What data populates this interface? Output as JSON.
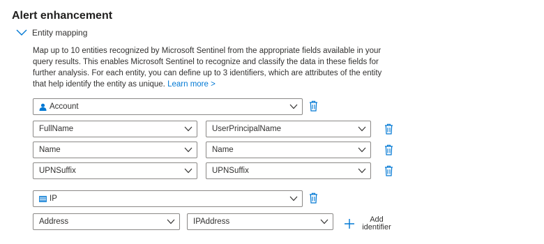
{
  "section": {
    "title": "Alert enhancement"
  },
  "entity_mapping": {
    "label": "Entity mapping",
    "description": "Map up to 10 entities recognized by Microsoft Sentinel from the appropriate fields available in your query results. This enables Microsoft Sentinel to recognize and classify the data in these fields for further analysis. For each entity, you can define up to 3 identifiers, which are attributes of the entity that help identify the entity as unique.",
    "learn_more": "Learn more >"
  },
  "entities": [
    {
      "type": "Account",
      "icon": "account-icon",
      "identifiers": [
        {
          "identifier": "FullName",
          "column": "UserPrincipalName"
        },
        {
          "identifier": "Name",
          "column": "Name"
        },
        {
          "identifier": "UPNSuffix",
          "column": "UPNSuffix"
        }
      ]
    },
    {
      "type": "IP",
      "icon": "ip-icon",
      "identifiers": [
        {
          "identifier": "Address",
          "column": "IPAddress"
        }
      ]
    }
  ],
  "add_identifier_label": "Add identifier",
  "colors": {
    "accent": "#0078d4",
    "border": "#8a8886",
    "text": "#323130"
  }
}
